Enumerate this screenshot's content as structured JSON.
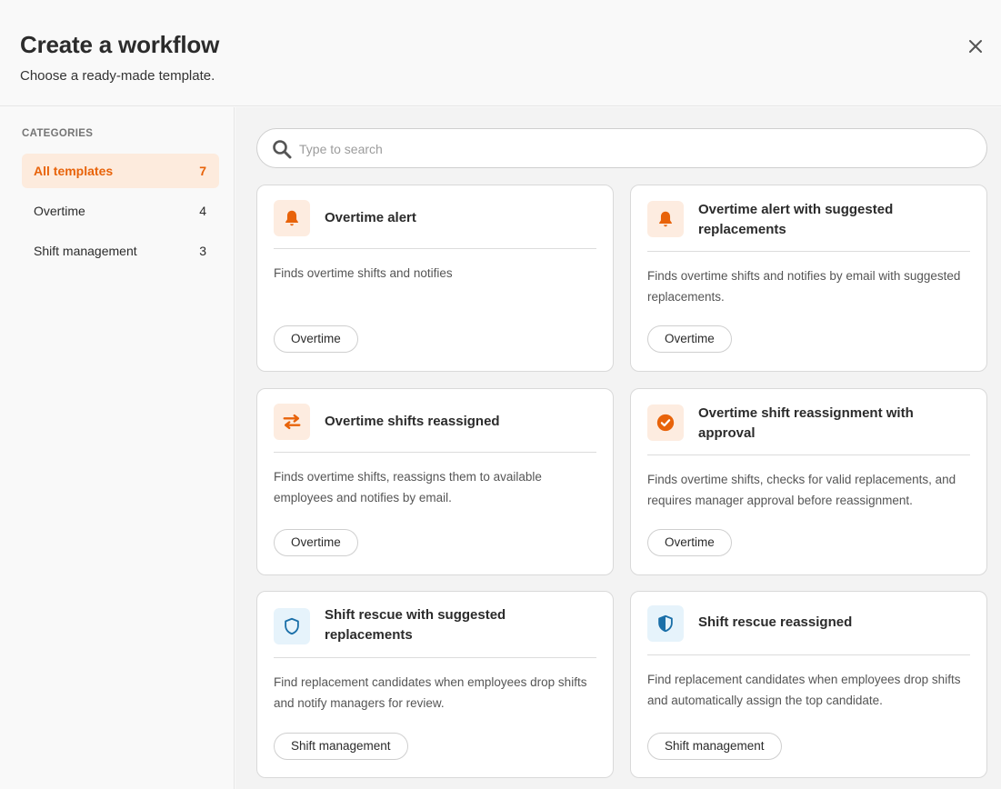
{
  "header": {
    "title": "Create a workflow",
    "subtitle": "Choose a ready-made template."
  },
  "sidebar": {
    "heading": "CATEGORIES",
    "items": [
      {
        "label": "All templates",
        "count": "7",
        "active": true
      },
      {
        "label": "Overtime",
        "count": "4",
        "active": false
      },
      {
        "label": "Shift management",
        "count": "3",
        "active": false
      }
    ]
  },
  "search": {
    "placeholder": "Type to search"
  },
  "cards": [
    {
      "icon": "bell-icon",
      "title": "Overtime alert",
      "description": "Finds overtime shifts and notifies",
      "tag": "Overtime"
    },
    {
      "icon": "bell-icon",
      "title": "Overtime alert with suggested replacements",
      "description": "Finds overtime shifts and notifies by email with suggested replacements.",
      "tag": "Overtime"
    },
    {
      "icon": "swap-arrows-icon",
      "title": "Overtime shifts reassigned",
      "description": "Finds overtime shifts, reassigns them to available employees and notifies by email.",
      "tag": "Overtime"
    },
    {
      "icon": "check-circle-icon",
      "title": "Overtime shift reassignment with approval",
      "description": "Finds overtime shifts, checks for valid replacements, and requires manager approval before reassignment.",
      "tag": "Overtime"
    },
    {
      "icon": "shield-outline-icon",
      "title": "Shift rescue with suggested replacements",
      "description": "Find replacement candidates when employees drop shifts and notify managers for review.",
      "tag": "Shift management"
    },
    {
      "icon": "shield-half-icon",
      "title": "Shift rescue reassigned",
      "description": "Find replacement candidates when employees drop shifts and automatically assign the top candidate.",
      "tag": "Shift management"
    }
  ],
  "colors": {
    "accent": "#e8630a",
    "accent_bg": "#fdebdd",
    "shield_blue": "#1a6fa8"
  }
}
